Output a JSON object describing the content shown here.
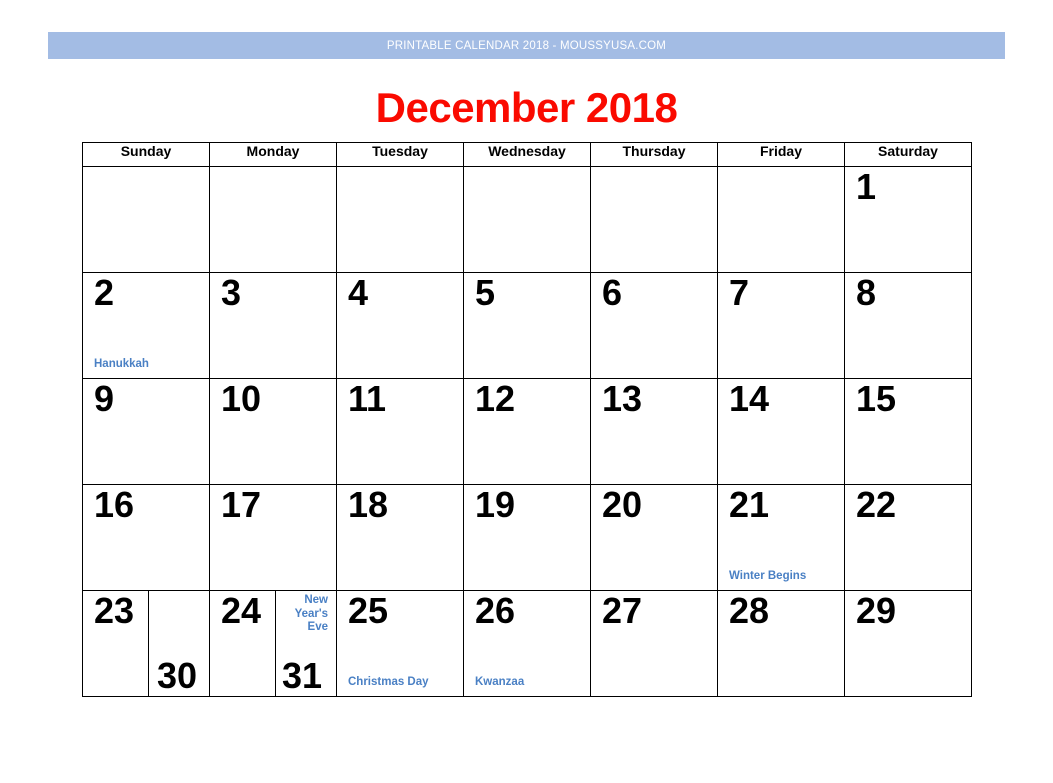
{
  "banner": {
    "text": "PRINTABLE CALENDAR 2018 - MOUSSYUSA.COM",
    "background_color": "#a3bce4",
    "text_color": "#ffffff"
  },
  "title": {
    "text": "December 2018",
    "color": "#fa0a00"
  },
  "colors": {
    "event_blue": "#4a80c4",
    "grid_line": "#000000",
    "day_number": "#000000",
    "page_background": "#ffffff"
  },
  "calendar": {
    "month": "December",
    "year": "2018",
    "weekdays": [
      "Sunday",
      "Monday",
      "Tuesday",
      "Wednesday",
      "Thursday",
      "Friday",
      "Saturday"
    ],
    "weeks": [
      {
        "cells": [
          {
            "day": "",
            "event": ""
          },
          {
            "day": "",
            "event": ""
          },
          {
            "day": "",
            "event": ""
          },
          {
            "day": "",
            "event": ""
          },
          {
            "day": "",
            "event": ""
          },
          {
            "day": "",
            "event": ""
          },
          {
            "day": "1",
            "event": ""
          }
        ]
      },
      {
        "cells": [
          {
            "day": "2",
            "event": "Hanukkah"
          },
          {
            "day": "3",
            "event": ""
          },
          {
            "day": "4",
            "event": ""
          },
          {
            "day": "5",
            "event": ""
          },
          {
            "day": "6",
            "event": ""
          },
          {
            "day": "7",
            "event": ""
          },
          {
            "day": "8",
            "event": ""
          }
        ]
      },
      {
        "cells": [
          {
            "day": "9",
            "event": ""
          },
          {
            "day": "10",
            "event": ""
          },
          {
            "day": "11",
            "event": ""
          },
          {
            "day": "12",
            "event": ""
          },
          {
            "day": "13",
            "event": ""
          },
          {
            "day": "14",
            "event": ""
          },
          {
            "day": "15",
            "event": ""
          }
        ]
      },
      {
        "cells": [
          {
            "day": "16",
            "event": ""
          },
          {
            "day": "17",
            "event": ""
          },
          {
            "day": "18",
            "event": ""
          },
          {
            "day": "19",
            "event": ""
          },
          {
            "day": "20",
            "event": ""
          },
          {
            "day": "21",
            "event": "Winter Begins"
          },
          {
            "day": "22",
            "event": ""
          }
        ]
      },
      {
        "cells": [
          {
            "day": "23",
            "event": "",
            "split_day": "30",
            "split_event": ""
          },
          {
            "day": "24",
            "event": "",
            "split_day": "31",
            "split_event": "New Year's Eve"
          },
          {
            "day": "25",
            "event": "Christmas Day"
          },
          {
            "day": "26",
            "event": "Kwanzaa"
          },
          {
            "day": "27",
            "event": ""
          },
          {
            "day": "28",
            "event": ""
          },
          {
            "day": "29",
            "event": ""
          }
        ]
      }
    ]
  }
}
